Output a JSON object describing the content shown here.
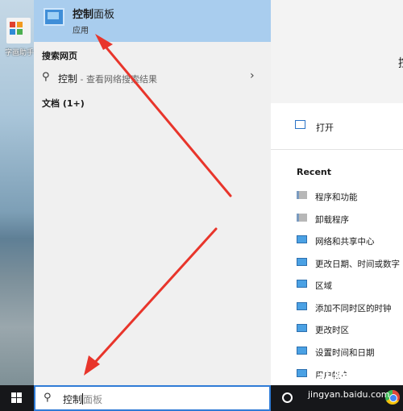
{
  "desktop": {
    "icon_label": "字画助手"
  },
  "best_match": {
    "title_bold": "控制",
    "title_rest": "面板",
    "subtitle": "应用"
  },
  "web_section": {
    "label": "搜索网页",
    "query": "控制",
    "suffix": " - 查看网络搜索结果"
  },
  "documents": {
    "label": "文档 (1+)"
  },
  "detail": {
    "head_initial": "控",
    "open_label": "打开",
    "recent_label": "Recent",
    "recent_items": [
      {
        "label": "程序和功能",
        "icon": "programs-icon"
      },
      {
        "label": "卸载程序",
        "icon": "programs-icon"
      },
      {
        "label": "网络和共享中心",
        "icon": "control-panel-icon"
      },
      {
        "label": "更改日期、时间或数字",
        "icon": "control-panel-icon"
      },
      {
        "label": "区域",
        "icon": "control-panel-icon"
      },
      {
        "label": "添加不同时区的时钟",
        "icon": "control-panel-icon"
      },
      {
        "label": "更改时区",
        "icon": "control-panel-icon"
      },
      {
        "label": "设置时间和日期",
        "icon": "control-panel-icon"
      },
      {
        "label": "用户帐户",
        "icon": "control-panel-icon"
      }
    ]
  },
  "taskbar": {
    "search_typed": "控制",
    "search_ghost": "面板",
    "watermark_logo": "Bai 经验",
    "watermark_sub": "jingyan.baidu.com"
  },
  "annotation_color": "#e8352b"
}
